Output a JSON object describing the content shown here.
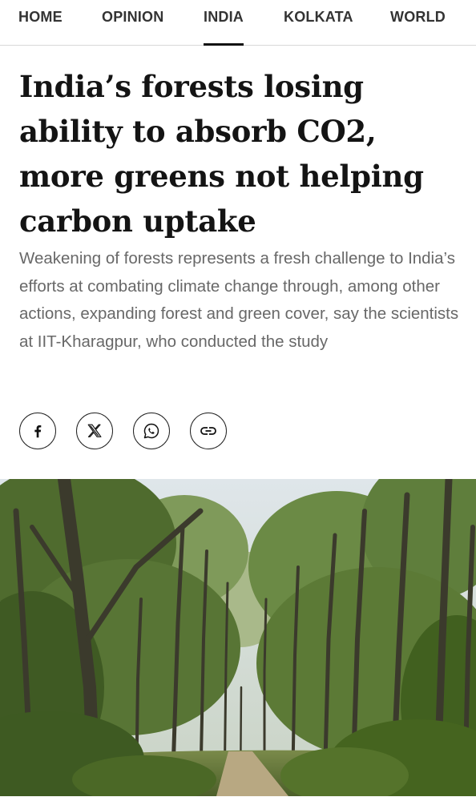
{
  "nav": {
    "items": [
      "HOME",
      "OPINION",
      "INDIA",
      "KOLKATA",
      "WORLD"
    ],
    "active_index": 2
  },
  "article": {
    "headline": "India’s forests losing ability to absorb CO2, more greens not helping carbon uptake",
    "subhead": "Weakening of forests represents a fresh challenge to India’s efforts at combating climate change through, among other actions, expanding forest and green cover, say the scientists at IIT-Kharagpur, who conducted the study"
  },
  "share": {
    "icons": [
      "facebook-icon",
      "x-icon",
      "whatsapp-icon",
      "link-icon"
    ]
  },
  "colors": {
    "nav_text": "#333333",
    "headline": "#141414",
    "subhead": "#686868",
    "active_underline": "#111111"
  }
}
